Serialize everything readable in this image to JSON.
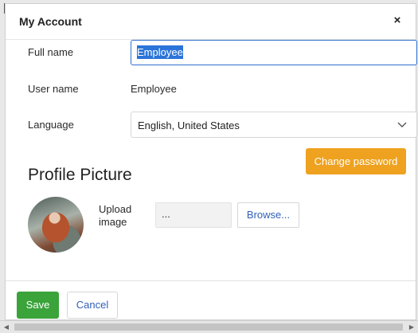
{
  "dialog": {
    "title": "My Account",
    "close_label": "×"
  },
  "form": {
    "full_name_label": "Full name",
    "full_name_value": "Employee",
    "user_name_label": "User name",
    "user_name_value": "Employee",
    "language_label": "Language",
    "language_value": "English, United States",
    "change_password_label": "Change password"
  },
  "profile": {
    "section_title": "Profile Picture",
    "upload_label": "Upload image",
    "file_field_value": "...",
    "browse_label": "Browse..."
  },
  "footer": {
    "save_label": "Save",
    "cancel_label": "Cancel"
  },
  "icons": {
    "window_icon": "image-icon",
    "close_icon": "close-icon",
    "dropdown_icon": "chevron-down-icon"
  },
  "colors": {
    "primary_green": "#3aa33a",
    "accent_orange": "#eea220",
    "focus_blue": "#2f6fd1",
    "link_blue": "#2f5fb8"
  }
}
